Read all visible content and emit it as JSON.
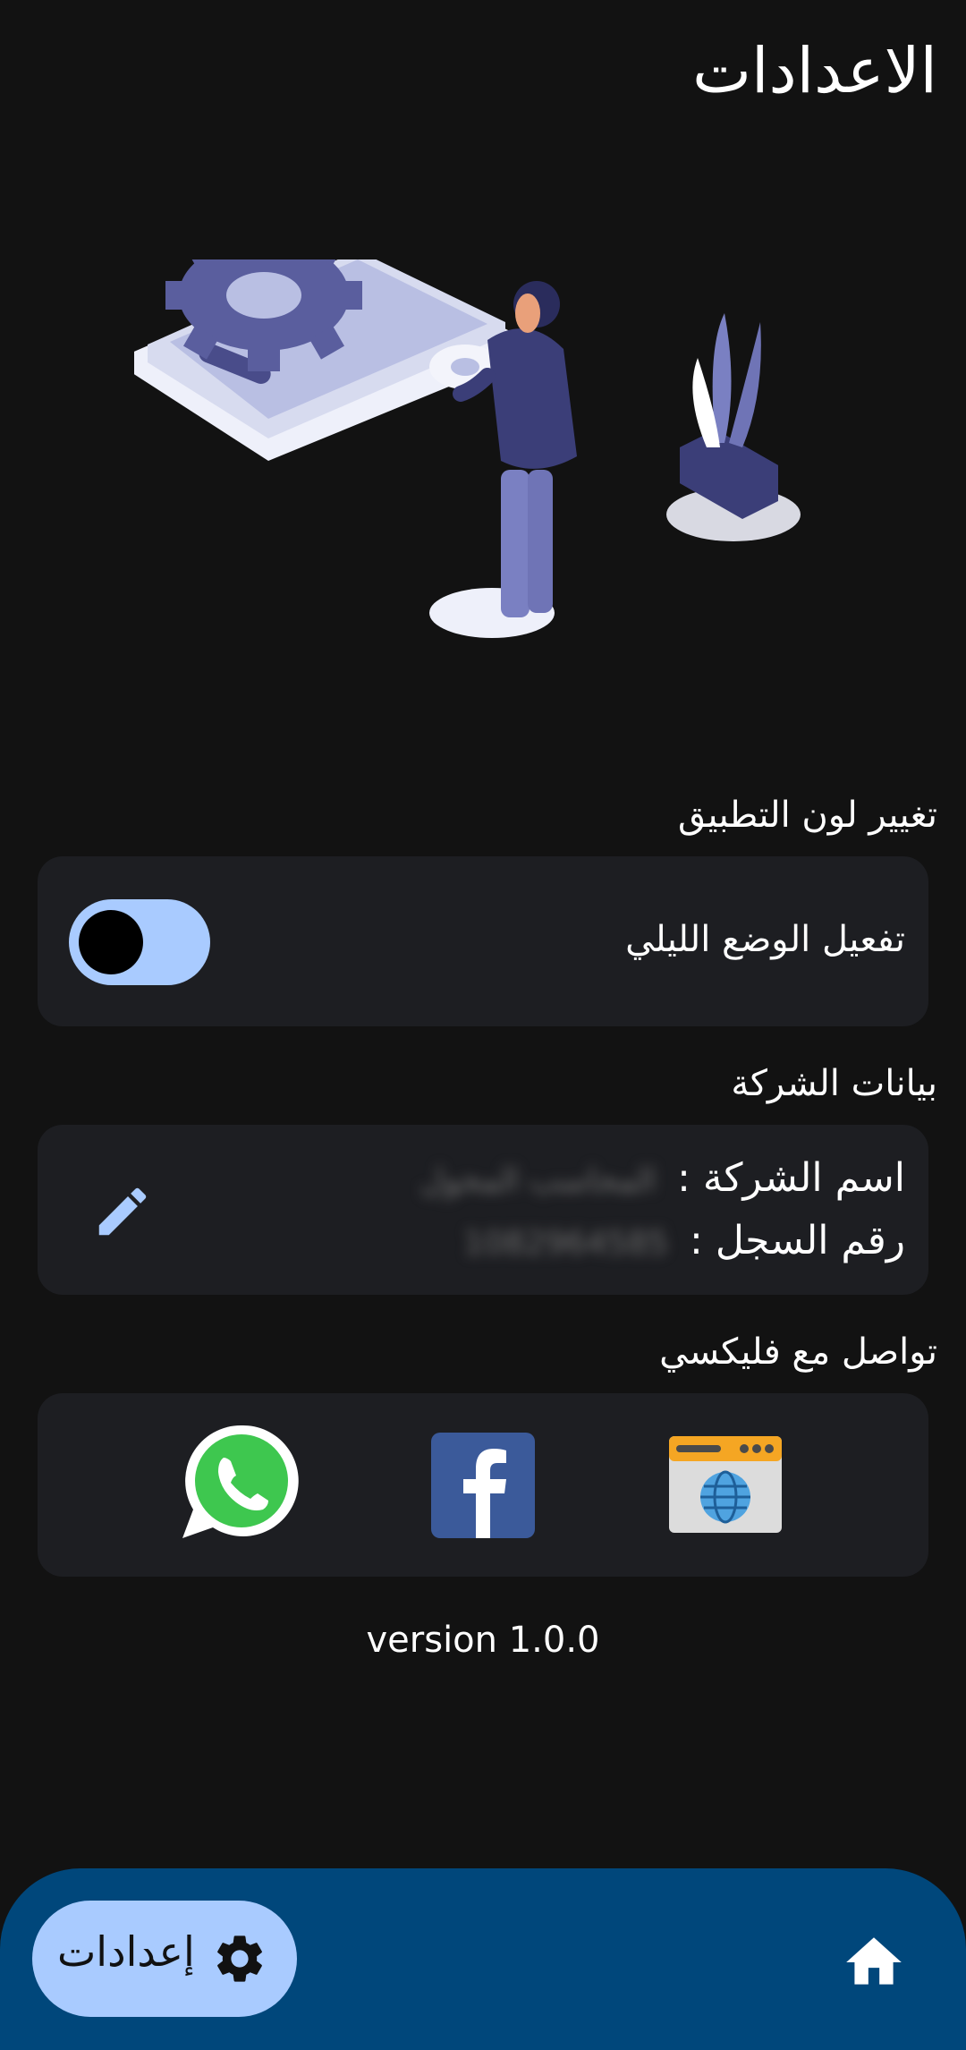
{
  "page": {
    "title": "الاعدادات"
  },
  "theme_section": {
    "title": "تغيير لون التطبيق",
    "dark_mode_label": "تفعيل الوضع الليلي",
    "dark_mode_enabled": true
  },
  "company_section": {
    "title": "بيانات الشركة",
    "name_label": "اسم الشركة :",
    "name_value": "المحاسب المحول",
    "register_label": "رقم السجل :",
    "register_value": "1082964585"
  },
  "contact_section": {
    "title": "تواصل مع فليكسي",
    "links": [
      {
        "icon": "whatsapp-icon"
      },
      {
        "icon": "facebook-icon"
      },
      {
        "icon": "website-icon"
      }
    ]
  },
  "footer": {
    "version": "version 1.0.0"
  },
  "bottom_nav": {
    "settings_label": "إعدادات",
    "settings_icon": "gear-icon",
    "home_icon": "home-icon"
  },
  "colors": {
    "background": "#121212",
    "card": "#1d1e22",
    "accent": "#a9cbff",
    "nav_bar": "#00477b"
  }
}
